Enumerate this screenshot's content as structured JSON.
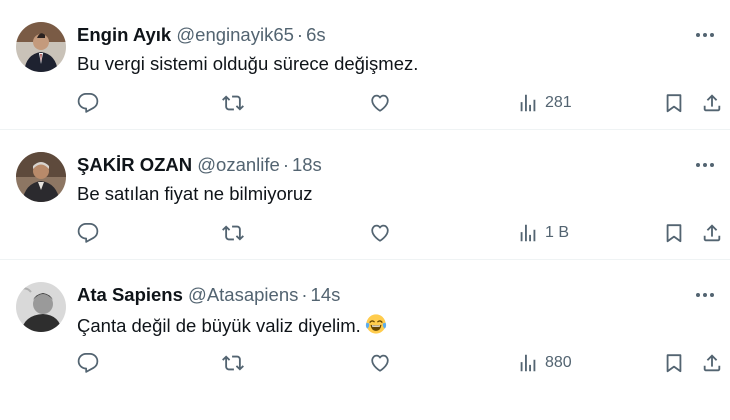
{
  "tweets": [
    {
      "name": "Engin Ayık",
      "handle": "@enginayik65",
      "time": "6s",
      "text": "Bu vergi sistemi olduğu sürece değişmez.",
      "views": "281",
      "avatar_color": "#5a3a2a"
    },
    {
      "name": "ŞAKİR OZAN",
      "handle": "@ozanlife",
      "time": "18s",
      "text": "Be satılan fiyat ne bilmiyoruz",
      "views": "1 B",
      "avatar_color": "#6b4f3a"
    },
    {
      "name": "Ata Sapiens",
      "handle": "@Atasapiens",
      "time": "14s",
      "text": "Çanta değil de büyük valiz diyelim.",
      "emoji": "face-with-tears-of-joy",
      "views": "880",
      "avatar_color": "#888888"
    }
  ],
  "separator": "·",
  "icons": [
    "reply-icon",
    "retweet-icon",
    "like-icon",
    "views-icon",
    "bookmark-icon",
    "share-icon",
    "more-icon"
  ],
  "colors": {
    "text": "#0f1419",
    "secondary": "#536471",
    "divider": "#eff3f4"
  }
}
